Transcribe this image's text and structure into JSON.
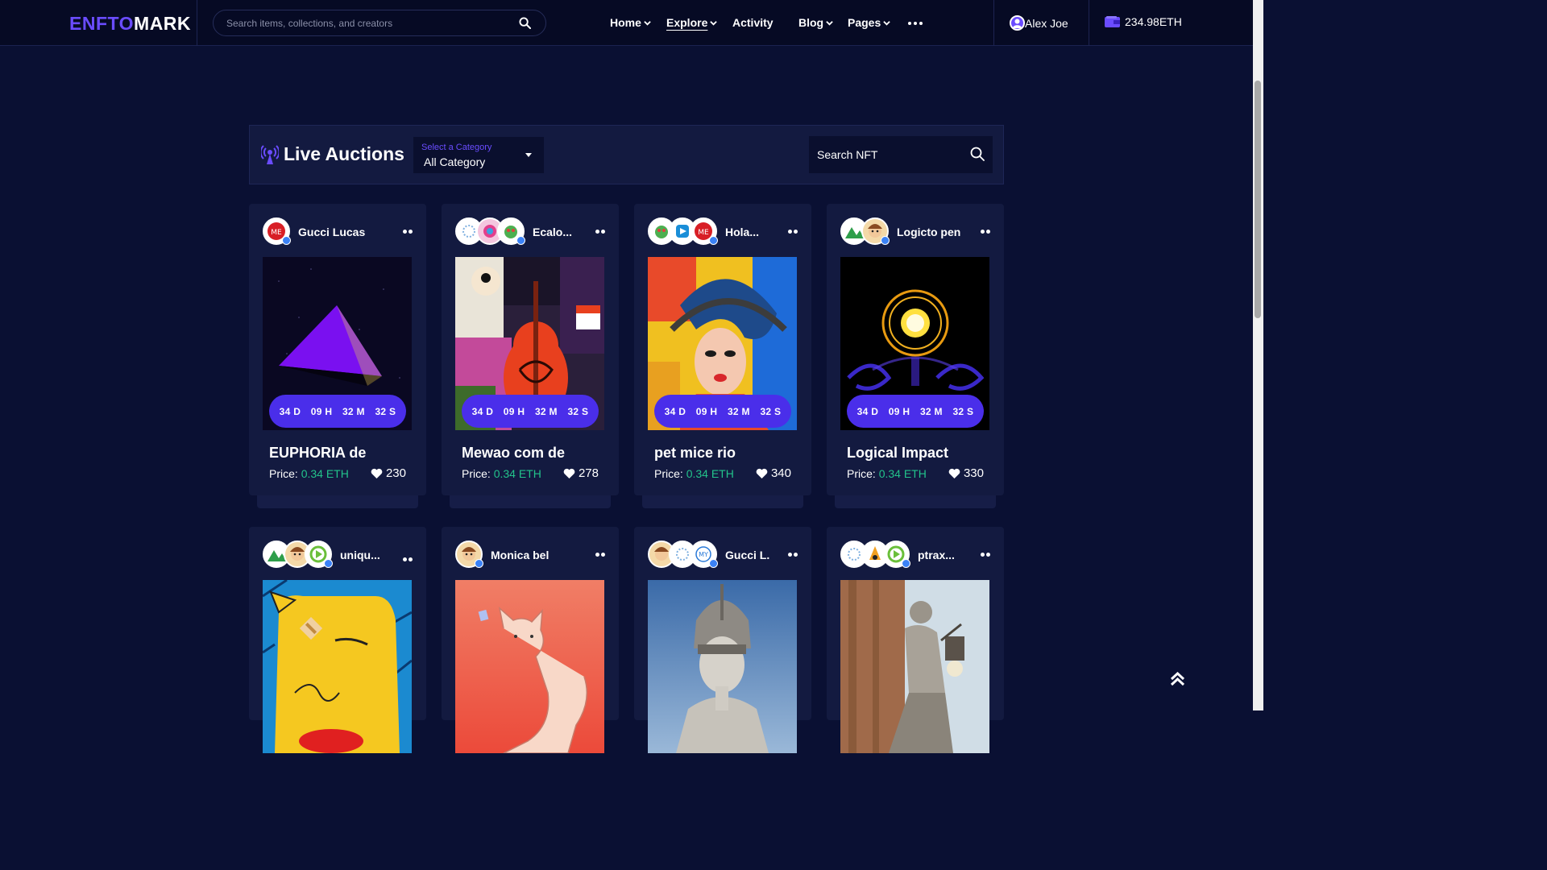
{
  "brand": {
    "part1": "ENFTO",
    "part2": "MARK"
  },
  "search": {
    "placeholder": "Search items, collections, and creators"
  },
  "nav": [
    {
      "label": "Home",
      "dropdown": true
    },
    {
      "label": "Explore",
      "dropdown": true,
      "active": true
    },
    {
      "label": "Activity",
      "dropdown": false
    },
    {
      "label": "Blog",
      "dropdown": true
    },
    {
      "label": "Pages",
      "dropdown": true
    }
  ],
  "user": {
    "name": "Alex Joe"
  },
  "wallet": {
    "balance": "234.98ETH"
  },
  "section": {
    "title": "Live Auctions",
    "category_label": "Select a Category",
    "category_value": "All Category",
    "search_placeholder": "Search NFT"
  },
  "timer": {
    "d": "34 D",
    "h": "09 H",
    "m": "32 M",
    "s": "32 S"
  },
  "price_label": "Price:",
  "cards": [
    {
      "creator": "Gucci Lucas",
      "name": "EUPHORIA de",
      "price": "0.34 ETH",
      "likes": "230",
      "art": "pyramid"
    },
    {
      "creator": "Ecalo...",
      "name": "Mewao com de",
      "price": "0.34 ETH",
      "likes": "278",
      "art": "cello"
    },
    {
      "creator": "Hola...",
      "name": "pet mice rio",
      "price": "0.34 ETH",
      "likes": "340",
      "art": "woman"
    },
    {
      "creator": "Logicto pen",
      "name": "Logical Impact",
      "price": "0.34 ETH",
      "likes": "330",
      "art": "orb"
    },
    {
      "creator": "uniqu...",
      "art": "bear"
    },
    {
      "creator": "Monica bel",
      "art": "cat"
    },
    {
      "creator": "Gucci L.",
      "art": "statue"
    },
    {
      "creator": "ptrax...",
      "art": "sculpture"
    }
  ],
  "colors": {
    "accent": "#6a4cff",
    "timer": "#4a2eea",
    "eth": "#23c38b",
    "bg": "#0a1033"
  }
}
